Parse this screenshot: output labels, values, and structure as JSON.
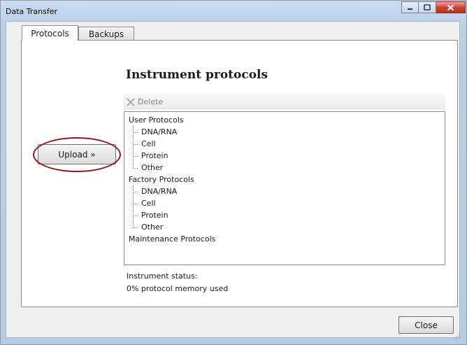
{
  "window": {
    "title": "Data Transfer",
    "close_color": "#c8412b"
  },
  "tabs": [
    {
      "label": "Protocols",
      "selected": true
    },
    {
      "label": "Backups",
      "selected": false
    }
  ],
  "main": {
    "heading": "Instrument protocols",
    "toolbar": {
      "delete_label": "Delete",
      "delete_icon": "x-icon",
      "delete_enabled": false
    },
    "upload_label": "Upload »",
    "annotation_color": "#8b1a1a",
    "tree": [
      {
        "label": "User Protocols",
        "children": [
          "DNA/RNA",
          "Cell",
          "Protein",
          "Other"
        ]
      },
      {
        "label": "Factory Protocols",
        "children": [
          "DNA/RNA",
          "Cell",
          "Protein",
          "Other"
        ]
      },
      {
        "label": "Maintenance Protocols",
        "children": []
      }
    ],
    "status_label": "Instrument status:",
    "status_value": "0% protocol memory used"
  },
  "footer": {
    "close_label": "Close"
  }
}
